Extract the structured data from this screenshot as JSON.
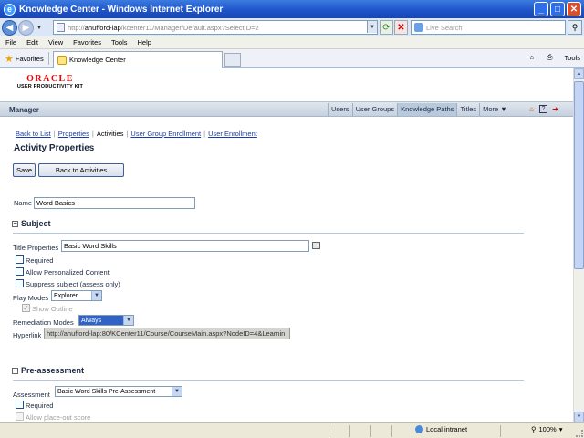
{
  "window": {
    "title": "Knowledge Center - Windows Internet Explorer",
    "minimize": "_",
    "maximize": "□",
    "close": "✕"
  },
  "address": {
    "url_prefix": "http://",
    "url_host": "ahufford-lap",
    "url_path": "/kcenter11/Manager/Default.aspx?SelectID=2",
    "search_placeholder": "Live Search"
  },
  "menu": [
    "File",
    "Edit",
    "View",
    "Favorites",
    "Tools",
    "Help"
  ],
  "favorites": {
    "label": "Favorites",
    "tab_title": "Knowledge Center",
    "tools_label": "Tools"
  },
  "brand": {
    "logo_word": "ORACLE",
    "logo_sub": "USER PRODUCTIVITY KIT"
  },
  "manager": {
    "title": "Manager",
    "tabs": [
      {
        "label": "Users",
        "active": false
      },
      {
        "label": "User Groups",
        "active": false
      },
      {
        "label": "Knowledge Paths",
        "active": true
      },
      {
        "label": "Titles",
        "active": false
      },
      {
        "label": "More ▼",
        "active": false
      }
    ]
  },
  "breadcrumb": {
    "back_to_list": "Back to List",
    "properties": "Properties",
    "activities": "Activities",
    "user_group_enrollment": "User Group Enrollment",
    "user_enrollment": "User Enrollment"
  },
  "page": {
    "title": "Activity Properties",
    "save_label": "Save",
    "back_label": "Back to Activities"
  },
  "form": {
    "name_label": "Name",
    "name_value": "Word Basics",
    "subject": {
      "heading": "Subject",
      "title_properties_label": "Title Properties",
      "title_properties_value": "Basic Word Skills",
      "required_label": "Required",
      "allow_personalized_label": "Allow Personalized Content",
      "suppress_label": "Suppress subject (assess only)",
      "play_modes_label": "Play Modes",
      "play_modes_value": "Explorer",
      "show_outline_label": "Show Outline",
      "remediation_label": "Remediation Modes",
      "remediation_value": "Always",
      "hyperlink_label": "Hyperlink",
      "hyperlink_value": "http://ahufford-lap:80/KCenter11/Course/CourseMain.aspx?NodeID=4&Learnin"
    },
    "preassessment": {
      "heading": "Pre-assessment",
      "assessment_label": "Assessment",
      "assessment_value": "Basic Word Skills Pre-Assessment",
      "required_label": "Required",
      "allow_placeout_label": "Allow place-out score"
    }
  },
  "status": {
    "zone": "Local intranet",
    "zoom": "100%"
  }
}
